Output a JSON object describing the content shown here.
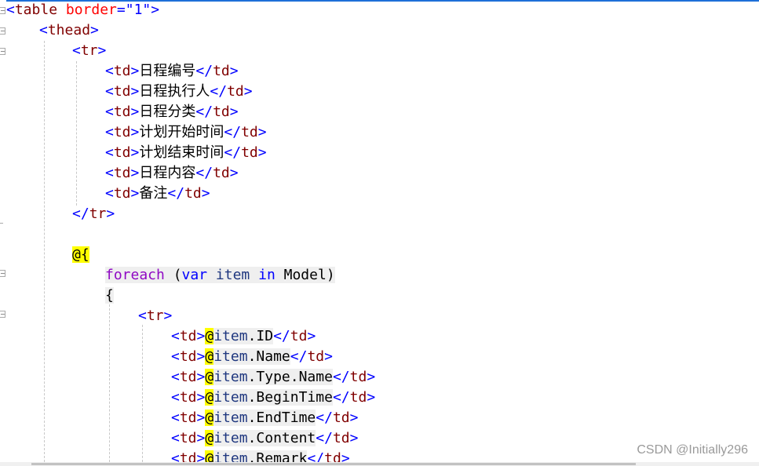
{
  "editor": {
    "lines": [
      {
        "name": "code-line-table-open",
        "indent": 8,
        "tokens": [
          {
            "c": "br",
            "t": "<"
          },
          {
            "c": "tag",
            "t": "table"
          },
          {
            "c": "plain",
            "t": " "
          },
          {
            "c": "attr",
            "t": "border"
          },
          {
            "c": "br",
            "t": "="
          },
          {
            "c": "val",
            "t": "\"1\""
          },
          {
            "c": "br",
            "t": ">"
          }
        ]
      },
      {
        "name": "code-line-thead-open",
        "indent": 50,
        "tokens": [
          {
            "c": "br",
            "t": "<"
          },
          {
            "c": "tag",
            "t": "thead"
          },
          {
            "c": "br",
            "t": ">"
          }
        ]
      },
      {
        "name": "code-line-tr-open",
        "indent": 92,
        "tokens": [
          {
            "c": "br",
            "t": "<"
          },
          {
            "c": "tag",
            "t": "tr"
          },
          {
            "c": "br",
            "t": ">"
          }
        ]
      },
      {
        "name": "code-line-td-schedule-no",
        "indent": 134,
        "tokens": [
          {
            "c": "br",
            "t": "<"
          },
          {
            "c": "tag",
            "t": "td"
          },
          {
            "c": "br",
            "t": ">"
          },
          {
            "c": "plain",
            "t": "日程编号"
          },
          {
            "c": "br",
            "t": "</"
          },
          {
            "c": "tag",
            "t": "td"
          },
          {
            "c": "br",
            "t": ">"
          }
        ]
      },
      {
        "name": "code-line-td-executor",
        "indent": 134,
        "tokens": [
          {
            "c": "br",
            "t": "<"
          },
          {
            "c": "tag",
            "t": "td"
          },
          {
            "c": "br",
            "t": ">"
          },
          {
            "c": "plain",
            "t": "日程执行人"
          },
          {
            "c": "br",
            "t": "</"
          },
          {
            "c": "tag",
            "t": "td"
          },
          {
            "c": "br",
            "t": ">"
          }
        ]
      },
      {
        "name": "code-line-td-category",
        "indent": 134,
        "tokens": [
          {
            "c": "br",
            "t": "<"
          },
          {
            "c": "tag",
            "t": "td"
          },
          {
            "c": "br",
            "t": ">"
          },
          {
            "c": "plain",
            "t": "日程分类"
          },
          {
            "c": "br",
            "t": "</"
          },
          {
            "c": "tag",
            "t": "td"
          },
          {
            "c": "br",
            "t": ">"
          }
        ]
      },
      {
        "name": "code-line-td-start-time",
        "indent": 134,
        "tokens": [
          {
            "c": "br",
            "t": "<"
          },
          {
            "c": "tag",
            "t": "td"
          },
          {
            "c": "br",
            "t": ">"
          },
          {
            "c": "plain",
            "t": "计划开始时间"
          },
          {
            "c": "br",
            "t": "</"
          },
          {
            "c": "tag",
            "t": "td"
          },
          {
            "c": "br",
            "t": ">"
          }
        ]
      },
      {
        "name": "code-line-td-end-time",
        "indent": 134,
        "tokens": [
          {
            "c": "br",
            "t": "<"
          },
          {
            "c": "tag",
            "t": "td"
          },
          {
            "c": "br",
            "t": ">"
          },
          {
            "c": "plain",
            "t": "计划结束时间"
          },
          {
            "c": "br",
            "t": "</"
          },
          {
            "c": "tag",
            "t": "td"
          },
          {
            "c": "br",
            "t": ">"
          }
        ]
      },
      {
        "name": "code-line-td-content",
        "indent": 134,
        "tokens": [
          {
            "c": "br",
            "t": "<"
          },
          {
            "c": "tag",
            "t": "td"
          },
          {
            "c": "br",
            "t": ">"
          },
          {
            "c": "plain",
            "t": "日程内容"
          },
          {
            "c": "br",
            "t": "</"
          },
          {
            "c": "tag",
            "t": "td"
          },
          {
            "c": "br",
            "t": ">"
          }
        ]
      },
      {
        "name": "code-line-td-remark",
        "indent": 134,
        "tokens": [
          {
            "c": "br",
            "t": "<"
          },
          {
            "c": "tag",
            "t": "td"
          },
          {
            "c": "br",
            "t": ">"
          },
          {
            "c": "plain",
            "t": "备注"
          },
          {
            "c": "br",
            "t": "</"
          },
          {
            "c": "tag",
            "t": "td"
          },
          {
            "c": "br",
            "t": ">"
          }
        ]
      },
      {
        "name": "code-line-tr-close",
        "indent": 92,
        "tokens": [
          {
            "c": "br",
            "t": "</"
          },
          {
            "c": "tag",
            "t": "tr"
          },
          {
            "c": "br",
            "t": ">"
          }
        ]
      },
      {
        "name": "code-line-blank",
        "indent": 92,
        "tokens": []
      },
      {
        "name": "code-line-razor-block-open",
        "indent": 92,
        "tokens": [
          {
            "c": "razor",
            "t": "@{"
          }
        ]
      },
      {
        "name": "code-line-foreach",
        "indent": 134,
        "tokens": [
          {
            "c": "ctl hl",
            "t": "foreach"
          },
          {
            "c": "plain hl",
            "t": " ("
          },
          {
            "c": "kw hl",
            "t": "var"
          },
          {
            "c": "plain hl",
            "t": " "
          },
          {
            "c": "id hl",
            "t": "item"
          },
          {
            "c": "plain hl",
            "t": " "
          },
          {
            "c": "kw hl",
            "t": "in"
          },
          {
            "c": "plain hl",
            "t": " Model)"
          }
        ]
      },
      {
        "name": "code-line-brace-open",
        "indent": 134,
        "tokens": [
          {
            "c": "plain hl",
            "t": "{"
          }
        ]
      },
      {
        "name": "code-line-tr-inner-open",
        "indent": 176,
        "tokens": [
          {
            "c": "br",
            "t": "<"
          },
          {
            "c": "tag",
            "t": "tr"
          },
          {
            "c": "br",
            "t": ">"
          }
        ]
      },
      {
        "name": "code-line-item-id",
        "indent": 218,
        "tokens": [
          {
            "c": "br",
            "t": "<"
          },
          {
            "c": "tag",
            "t": "td"
          },
          {
            "c": "br",
            "t": ">"
          },
          {
            "c": "razor",
            "t": "@"
          },
          {
            "c": "id hl",
            "t": "item"
          },
          {
            "c": "plain hl",
            "t": ".ID"
          },
          {
            "c": "br",
            "t": "</"
          },
          {
            "c": "tag",
            "t": "td"
          },
          {
            "c": "br",
            "t": ">"
          }
        ]
      },
      {
        "name": "code-line-item-name",
        "indent": 218,
        "tokens": [
          {
            "c": "br",
            "t": "<"
          },
          {
            "c": "tag",
            "t": "td"
          },
          {
            "c": "br",
            "t": ">"
          },
          {
            "c": "razor",
            "t": "@"
          },
          {
            "c": "id hl",
            "t": "item"
          },
          {
            "c": "plain hl",
            "t": ".Name"
          },
          {
            "c": "br",
            "t": "</"
          },
          {
            "c": "tag",
            "t": "td"
          },
          {
            "c": "br",
            "t": ">"
          }
        ]
      },
      {
        "name": "code-line-item-type-name",
        "indent": 218,
        "tokens": [
          {
            "c": "br",
            "t": "<"
          },
          {
            "c": "tag",
            "t": "td"
          },
          {
            "c": "br",
            "t": ">"
          },
          {
            "c": "razor",
            "t": "@"
          },
          {
            "c": "id hl",
            "t": "item"
          },
          {
            "c": "plain hl",
            "t": ".Type.Name"
          },
          {
            "c": "br",
            "t": "</"
          },
          {
            "c": "tag",
            "t": "td"
          },
          {
            "c": "br",
            "t": ">"
          }
        ]
      },
      {
        "name": "code-line-item-begin-time",
        "indent": 218,
        "tokens": [
          {
            "c": "br",
            "t": "<"
          },
          {
            "c": "tag",
            "t": "td"
          },
          {
            "c": "br",
            "t": ">"
          },
          {
            "c": "razor",
            "t": "@"
          },
          {
            "c": "id hl",
            "t": "item"
          },
          {
            "c": "plain hl",
            "t": ".BeginTime"
          },
          {
            "c": "br",
            "t": "</"
          },
          {
            "c": "tag",
            "t": "td"
          },
          {
            "c": "br",
            "t": ">"
          }
        ]
      },
      {
        "name": "code-line-item-end-time",
        "indent": 218,
        "tokens": [
          {
            "c": "br",
            "t": "<"
          },
          {
            "c": "tag",
            "t": "td"
          },
          {
            "c": "br",
            "t": ">"
          },
          {
            "c": "razor",
            "t": "@"
          },
          {
            "c": "id hl",
            "t": "item"
          },
          {
            "c": "plain hl",
            "t": ".EndTime"
          },
          {
            "c": "br",
            "t": "</"
          },
          {
            "c": "tag",
            "t": "td"
          },
          {
            "c": "br",
            "t": ">"
          }
        ]
      },
      {
        "name": "code-line-item-content",
        "indent": 218,
        "tokens": [
          {
            "c": "br",
            "t": "<"
          },
          {
            "c": "tag",
            "t": "td"
          },
          {
            "c": "br",
            "t": ">"
          },
          {
            "c": "razor",
            "t": "@"
          },
          {
            "c": "id hl",
            "t": "item"
          },
          {
            "c": "plain hl",
            "t": ".Content"
          },
          {
            "c": "br",
            "t": "</"
          },
          {
            "c": "tag",
            "t": "td"
          },
          {
            "c": "br",
            "t": ">"
          }
        ]
      },
      {
        "name": "code-line-item-remark",
        "indent": 218,
        "tokens": [
          {
            "c": "br",
            "t": "<"
          },
          {
            "c": "tag",
            "t": "td"
          },
          {
            "c": "br",
            "t": ">"
          },
          {
            "c": "razor",
            "t": "@"
          },
          {
            "c": "id hl",
            "t": "item"
          },
          {
            "c": "plain hl",
            "t": ".Remark"
          },
          {
            "c": "br",
            "t": "</"
          },
          {
            "c": "tag",
            "t": "td"
          },
          {
            "c": "br",
            "t": ">"
          }
        ]
      }
    ]
  },
  "watermark": "CSDN @Initially296",
  "colors": {
    "tag_bracket": "#0000ff",
    "tag_name": "#800000",
    "attribute": "#ff0000",
    "keyword": "#0000ff",
    "control_keyword": "#8f08c4",
    "razor_highlight": "#ffff00",
    "code_highlight": "#efefef",
    "accent_rule": "#1d6fd8"
  },
  "icons": [
    "fold-collapse-icon"
  ]
}
